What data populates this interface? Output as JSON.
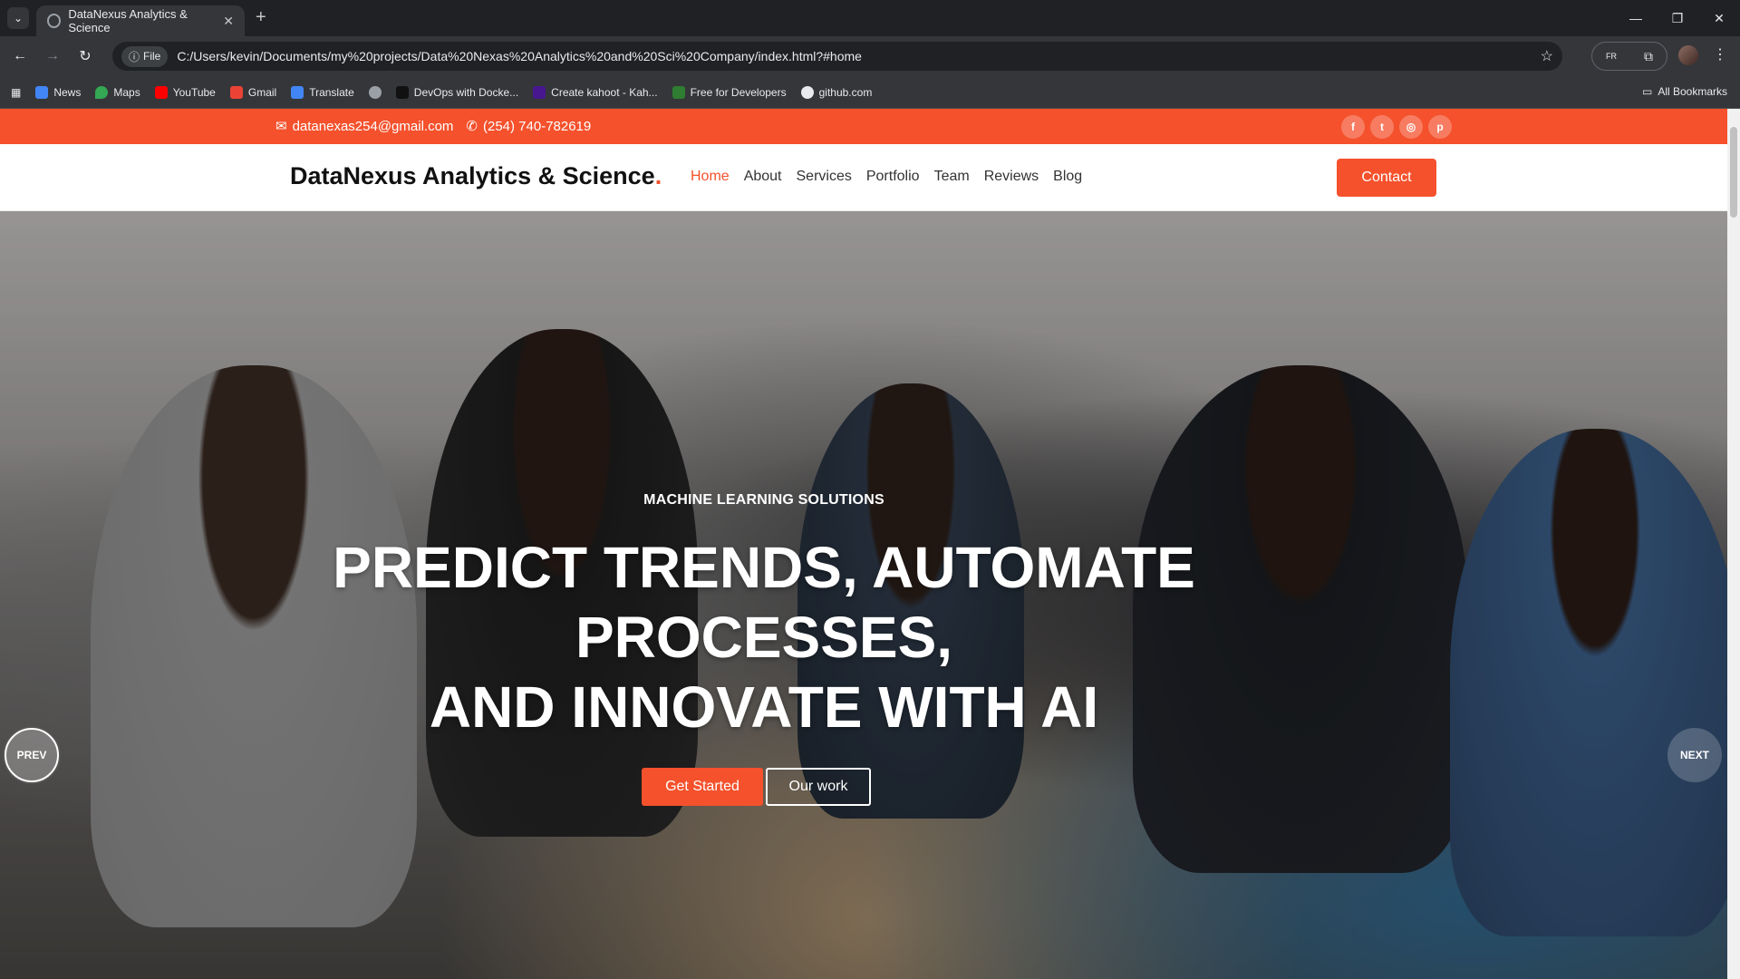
{
  "browser": {
    "tab_title": "DataNexus Analytics & Science",
    "url_chip": "File",
    "url": "C:/Users/kevin/Documents/my%20projects/Data%20Nexas%20Analytics%20and%20Sci%20Company/index.html?#home",
    "bookmarks": [
      "News",
      "Maps",
      "YouTube",
      "Gmail",
      "Translate",
      "DevOps with Docke...",
      "Create kahoot - Kah...",
      "Free for Developers",
      "github.com"
    ],
    "all_bookmarks": "All Bookmarks",
    "ext_badge": "FR"
  },
  "topbar": {
    "email": "datanexas254@gmail.com",
    "phone": "(254) 740-782619",
    "socials": [
      "facebook-icon",
      "twitter-icon",
      "instagram-icon",
      "pinterest-icon"
    ]
  },
  "header": {
    "logo": "DataNexus Analytics & Science",
    "logo_dot": ".",
    "nav": [
      "Home",
      "About",
      "Services",
      "Portfolio",
      "Team",
      "Reviews",
      "Blog"
    ],
    "contact": "Contact"
  },
  "hero": {
    "subtitle": "MACHINE LEARNING SOLUTIONS",
    "title_lines": [
      "PREDICT TRENDS, AUTOMATE",
      "PROCESSES,",
      "AND INNOVATE WITH AI"
    ],
    "primary_button": "Get Started",
    "secondary_button": "Our work",
    "prev": "PREV",
    "next": "NEXT"
  },
  "colors": {
    "accent": "#f4512c"
  }
}
